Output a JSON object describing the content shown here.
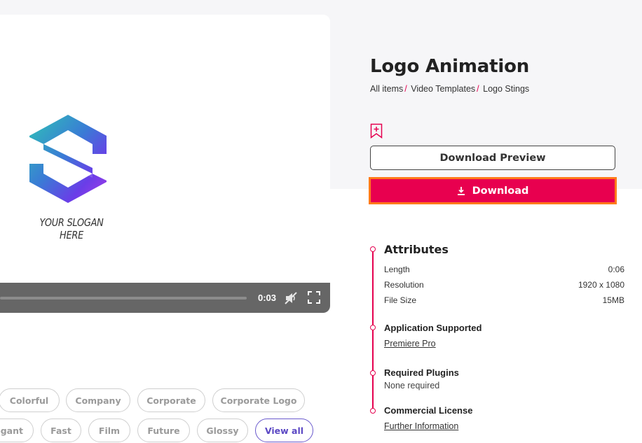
{
  "preview": {
    "slogan": "YOUR SLOGAN HERE",
    "time": "0:03"
  },
  "item": {
    "title": "Logo Animation",
    "breadcrumb": [
      "All items",
      "Video Templates",
      "Logo Stings"
    ],
    "preview_button": "Download Preview",
    "download_button": "Download"
  },
  "attributes": {
    "title": "Attributes",
    "rows": [
      {
        "label": "Length",
        "value": "0:06"
      },
      {
        "label": "Resolution",
        "value": "1920 x 1080"
      },
      {
        "label": "File Size",
        "value": "15MB"
      }
    ],
    "app_title": "Application Supported",
    "app_value": "Premiere Pro",
    "plugins_title": "Required Plugins",
    "plugins_value": "None required",
    "license_title": "Commercial License",
    "license_link": "Further Information"
  },
  "tags": [
    "Colorful",
    "Company",
    "Corporate",
    "Corporate Logo",
    "egant",
    "Fast",
    "Film",
    "Future",
    "Glossy",
    "View all"
  ],
  "colors": {
    "accent": "#e5004f",
    "focus_outline": "#ff7a1a",
    "view_all": "#5b48c4"
  }
}
